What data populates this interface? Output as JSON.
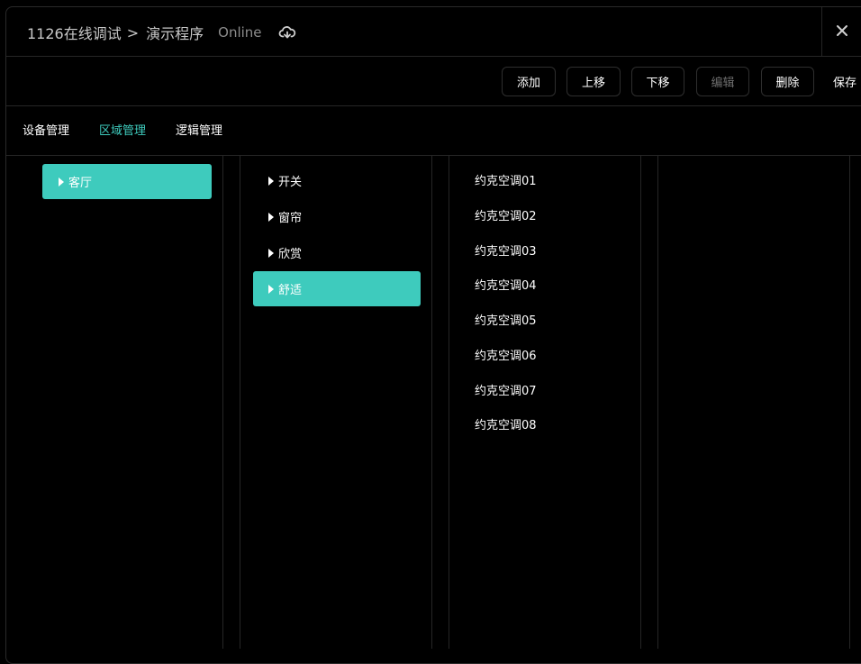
{
  "header": {
    "project": "1126在线调试",
    "separator": ">",
    "program": "演示程序",
    "status": "Online"
  },
  "toolbar": {
    "add": "添加",
    "move_up": "上移",
    "move_down": "下移",
    "edit": "编辑",
    "delete": "删除",
    "save": "保存"
  },
  "tabs": [
    {
      "label": "设备管理",
      "active": false
    },
    {
      "label": "区域管理",
      "active": true
    },
    {
      "label": "逻辑管理",
      "active": false
    }
  ],
  "areas": [
    {
      "label": "客厅",
      "selected": true
    }
  ],
  "scenes": [
    {
      "label": "开关",
      "selected": false
    },
    {
      "label": "窗帘",
      "selected": false
    },
    {
      "label": "欣赏",
      "selected": false
    },
    {
      "label": "舒适",
      "selected": true
    }
  ],
  "devices": [
    "约克空调01",
    "约克空调02",
    "约克空调03",
    "约克空调04",
    "约克空调05",
    "约克空调06",
    "约克空调07",
    "约克空调08"
  ],
  "colors": {
    "accent": "#3ecbbd",
    "background": "#000000",
    "divider": "#262626"
  },
  "icons": {
    "cloud": "cloud-sync-icon",
    "close": "close-icon",
    "expand": "caret-right-icon"
  }
}
